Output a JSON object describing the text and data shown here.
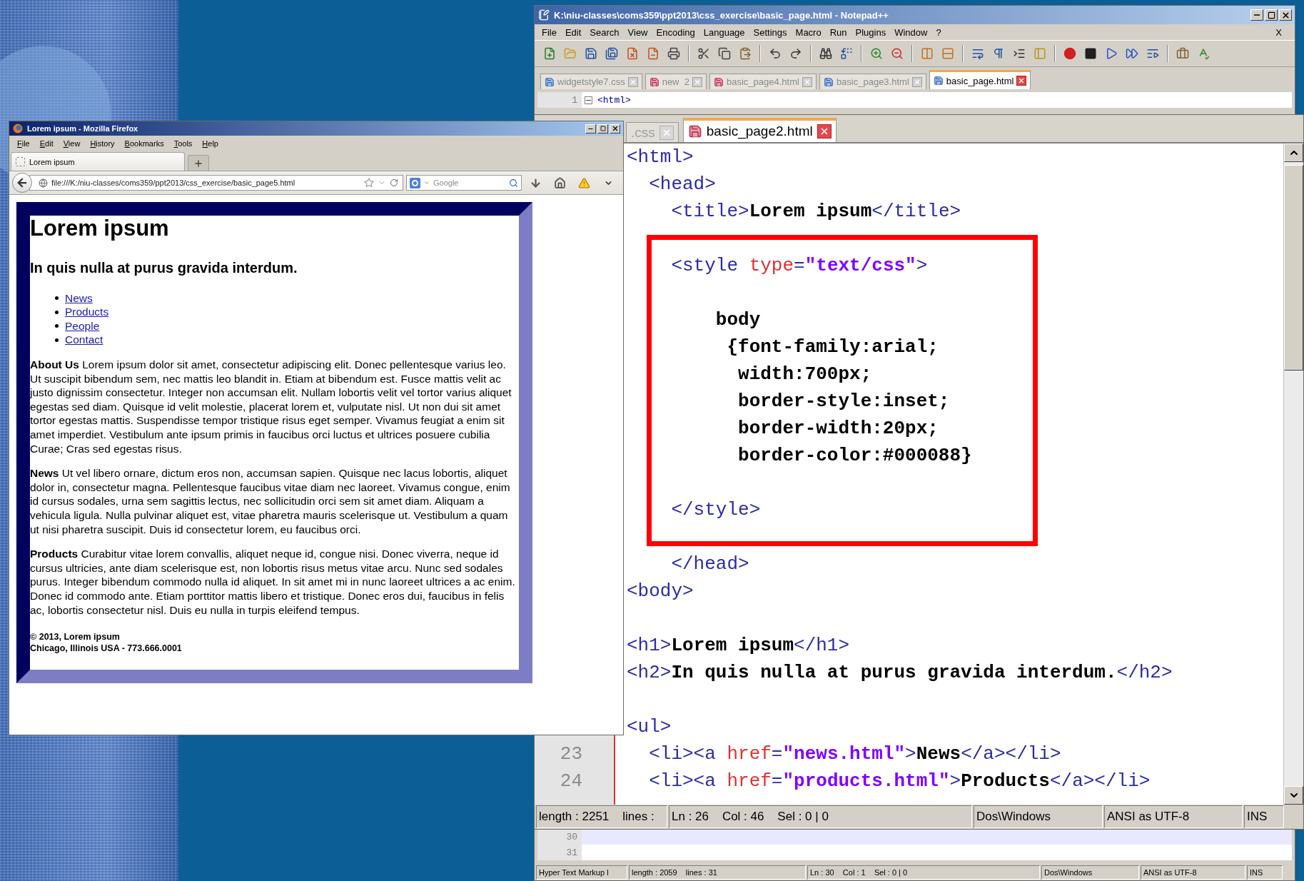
{
  "notepad": {
    "title": "K:\\niu-classes\\coms359\\ppt2013\\css_exercise\\basic_page.html - Notepad++",
    "menu": [
      "File",
      "Edit",
      "Search",
      "View",
      "Encoding",
      "Language",
      "Settings",
      "Macro",
      "Run",
      "Plugins",
      "Window",
      "?"
    ],
    "menu_close": "X",
    "tabs": [
      {
        "label": "widgetstyle7.css",
        "selected": false,
        "modified": false
      },
      {
        "label": "new  2",
        "selected": false,
        "modified": true
      },
      {
        "label": "basic_page4.html",
        "selected": false,
        "modified": true
      },
      {
        "label": "basic_page3.html",
        "selected": false,
        "modified": false
      },
      {
        "label": "basic_page.html",
        "selected": true,
        "modified": false
      }
    ],
    "top_lines": [
      {
        "number": "1",
        "code": "<html>",
        "foldable": true,
        "current": false
      }
    ],
    "bottom_lines": [
      {
        "number": "30",
        "foldable": false,
        "current": true
      },
      {
        "number": "31",
        "foldable": false,
        "current": false
      }
    ],
    "status_bar": [
      "Hyper Text Markup l",
      "length : 2059    lines : 31",
      "Ln : 30    Col : 1    Sel : 0 | 0",
      "Dos\\Windows",
      "ANSI as UTF-8",
      "INS"
    ]
  },
  "zoomed_editor": {
    "tabs": [
      {
        "label": ".css",
        "selected": false
      },
      {
        "label": "basic_page2.html",
        "selected": true,
        "modified": true
      }
    ],
    "lines": [
      {
        "kind": "code",
        "tokens": [
          {
            "kind": "tag",
            "text": "<html>"
          }
        ]
      },
      {
        "kind": "code",
        "tokens": [
          {
            "kind": "tag",
            "text": "  <head>"
          }
        ]
      },
      {
        "kind": "code",
        "tokens": [
          {
            "kind": "tag",
            "text": "    <title>"
          },
          {
            "kind": "text",
            "text": "Lorem ipsum"
          },
          {
            "kind": "tag",
            "text": "</title>"
          }
        ]
      },
      {
        "kind": "blank"
      },
      {
        "kind": "code",
        "tokens": [
          {
            "kind": "tag",
            "text": "    <style "
          },
          {
            "kind": "attr",
            "text": "type"
          },
          {
            "kind": "tag",
            "text": "="
          },
          {
            "kind": "value",
            "text": "\"text/css\""
          },
          {
            "kind": "tag",
            "text": ">"
          }
        ]
      },
      {
        "kind": "blank"
      },
      {
        "kind": "code",
        "tokens": [
          {
            "kind": "text",
            "text": "        body"
          }
        ]
      },
      {
        "kind": "code",
        "tokens": [
          {
            "kind": "text",
            "text": "         {font-family:arial;"
          }
        ]
      },
      {
        "kind": "code",
        "tokens": [
          {
            "kind": "text",
            "text": "          width:700px;"
          }
        ]
      },
      {
        "kind": "code",
        "tokens": [
          {
            "kind": "text",
            "text": "          border-style:inset;"
          }
        ]
      },
      {
        "kind": "code",
        "tokens": [
          {
            "kind": "text",
            "text": "          border-width:20px;"
          }
        ]
      },
      {
        "kind": "code",
        "tokens": [
          {
            "kind": "text",
            "text": "          border-color:#000088}"
          }
        ]
      },
      {
        "kind": "blank"
      },
      {
        "kind": "code",
        "tokens": [
          {
            "kind": "tag",
            "text": "    </style>"
          }
        ]
      },
      {
        "kind": "blank"
      },
      {
        "kind": "code",
        "tokens": [
          {
            "kind": "tag",
            "text": "    </head>"
          }
        ]
      },
      {
        "kind": "code",
        "tokens": [
          {
            "kind": "tag",
            "text": "<body>"
          }
        ]
      },
      {
        "kind": "blank"
      },
      {
        "kind": "code",
        "tokens": [
          {
            "kind": "tag",
            "text": "<h1>"
          },
          {
            "kind": "text",
            "text": "Lorem ipsum"
          },
          {
            "kind": "tag",
            "text": "</h1>"
          }
        ]
      },
      {
        "kind": "code",
        "tokens": [
          {
            "kind": "tag",
            "text": "<h2>"
          },
          {
            "kind": "text",
            "text": "In quis nulla at purus gravida interdum."
          },
          {
            "kind": "tag",
            "text": "</h2>"
          }
        ]
      },
      {
        "kind": "blank"
      },
      {
        "kind": "code",
        "tokens": [
          {
            "kind": "tag",
            "text": "<ul>"
          }
        ]
      },
      {
        "kind": "code",
        "number": "23",
        "tokens": [
          {
            "kind": "tag",
            "text": "  <li><a "
          },
          {
            "kind": "attr",
            "text": "href"
          },
          {
            "kind": "tag",
            "text": "="
          },
          {
            "kind": "value",
            "text": "\"news.html\""
          },
          {
            "kind": "tag",
            "text": ">"
          },
          {
            "kind": "text",
            "text": "News"
          },
          {
            "kind": "tag",
            "text": "</a></li>"
          }
        ]
      },
      {
        "kind": "code",
        "number": "24",
        "tokens": [
          {
            "kind": "tag",
            "text": "  <li><a "
          },
          {
            "kind": "attr",
            "text": "href"
          },
          {
            "kind": "tag",
            "text": "="
          },
          {
            "kind": "value",
            "text": "\"products.html\""
          },
          {
            "kind": "tag",
            "text": ">"
          },
          {
            "kind": "text",
            "text": "Products"
          },
          {
            "kind": "tag",
            "text": "</a></li>"
          }
        ]
      }
    ],
    "status_bar": [
      "length : 2251    lines :",
      "Ln : 26    Col : 46    Sel : 0 | 0",
      "Dos\\Windows",
      "ANSI as UTF-8",
      "INS"
    ]
  },
  "firefox": {
    "title": "Lorem ipsum - Mozilla Firefox",
    "menu": [
      "File",
      "Edit",
      "View",
      "History",
      "Bookmarks",
      "Tools",
      "Help"
    ],
    "tabs": [
      {
        "label": "Lorem ipsum",
        "selected": true
      }
    ],
    "url": "file:///K:/niu-classes/coms359/ppt2013/css_exercise/basic_page5.html",
    "search": {
      "placeholder": "Google"
    },
    "page": {
      "h1": "Lorem ipsum",
      "h2": "In quis nulla at purus gravida interdum.",
      "links": [
        "News",
        "Products",
        "People",
        "Contact"
      ],
      "paragraphs": [
        "**About Us** Lorem ipsum dolor sit amet, consectetur adipiscing elit. Donec pellentesque varius leo. Ut suscipit bibendum sem, nec mattis leo blandit in. Etiam at bibendum est. Fusce mattis velit ac justo dignissim consectetur. Integer non accumsan elit. Nullam lobortis velit vel tortor varius aliquet egestas sed diam. Quisque id velit molestie, placerat lorem et, vulputate nisl. Ut non dui sit amet tortor egestas mattis. Suspendisse tempor tristique risus eget semper. Vivamus feugiat a enim sit amet imperdiet. Vestibulum ante ipsum primis in faucibus orci luctus et ultrices posuere cubilia Curae; Cras sed egestas risus.",
        "**News** Ut vel libero ornare, dictum eros non, accumsan sapien. Quisque nec lacus lobortis, aliquet dolor in, consectetur magna. Pellentesque faucibus vitae diam nec laoreet. Vivamus congue, enim id cursus sodales, urna sem sagittis lectus, nec sollicitudin orci sem sit amet diam. Aliquam a vehicula ligula. Nulla pulvinar aliquet est, vitae pharetra mauris scelerisque ut. Vestibulum a quam ut nisi pharetra suscipit. Duis id consectetur lorem, eu faucibus orci.",
        "**Products** Curabitur vitae lorem convallis, aliquet neque id, congue nisi. Donec viverra, neque id cursus ultricies, ante diam scelerisque est, non lobortis risus metus vitae arcu. Nunc sed sodales purus. Integer bibendum commodo nulla id aliquet. In sit amet mi in nunc laoreet ultrices a ac enim. Donec id commodo ante. Etiam porttitor mattis libero et tristique. Donec eros dui, faucibus in felis ac, lobortis consectetur nisl. Duis eu nulla in turpis eleifend tempus."
      ],
      "footer": [
        "© 2013, Lorem ipsum",
        "Chicago, Illinois USA - 773.666.0001"
      ]
    }
  }
}
